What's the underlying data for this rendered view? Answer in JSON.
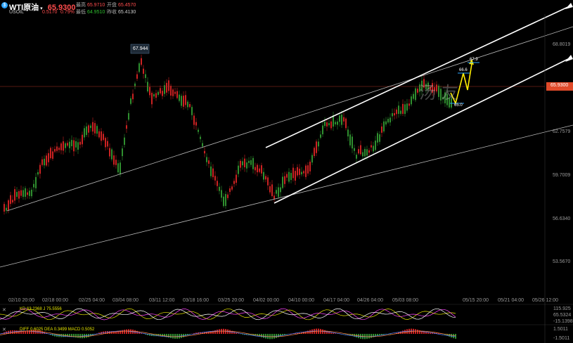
{
  "header": {
    "icon": "dollar-icon",
    "symbol_name": "WTI原油",
    "dropdown_glyph": "▾",
    "last_price": "65.9300",
    "code": "USOIL",
    "change": "0.5170",
    "change_pct": "0.79%",
    "stats": [
      {
        "label": "最高",
        "value": "65.9710"
      },
      {
        "label": "开盘",
        "value": "65.4570"
      },
      {
        "label": "最低",
        "value": "64.9510"
      },
      {
        "label": "昨收",
        "value": "65.4130"
      }
    ]
  },
  "colors": {
    "up": "#2f8f2f",
    "down": "#cc2222",
    "price_line": "#aa3322",
    "price_tag": "#e04a2a",
    "forecast": "#ffee00",
    "channel": "#ffffff"
  },
  "axis": {
    "price_labels": [
      "68.8019",
      "65.9300",
      "62.7579",
      "59.7009",
      "56.6340",
      "53.5670"
    ],
    "time_labels": [
      "02/10 20:00",
      "02/18 00:00",
      "02/25 04:00",
      "03/04 08:00",
      "03/11 12:00",
      "03/18 16:00",
      "03/25 20:00",
      "04/02 00:00",
      "04/10 00:00",
      "04/17 04:00",
      "04/26 04:00",
      "05/03 08:00",
      "05/15 20:00",
      "05/21 04:00",
      "05/26 12:00"
    ],
    "current_price_tag": "65.9300"
  },
  "annotations": {
    "peak_label": "67.944",
    "forecast_labels": [
      "66.6",
      "67.9",
      "65.0"
    ],
    "watermark": "汤友"
  },
  "indicators": {
    "kdj": {
      "legend": "KD 63.2368  J 75.5556",
      "values": [
        "115.925",
        "65.5324",
        "-15.1398"
      ]
    },
    "macd": {
      "legend": "DIFF 0.6025  DEA 0.3499  MACD 0.5052",
      "values": [
        "1.5011",
        "-1.5011"
      ]
    }
  }
}
